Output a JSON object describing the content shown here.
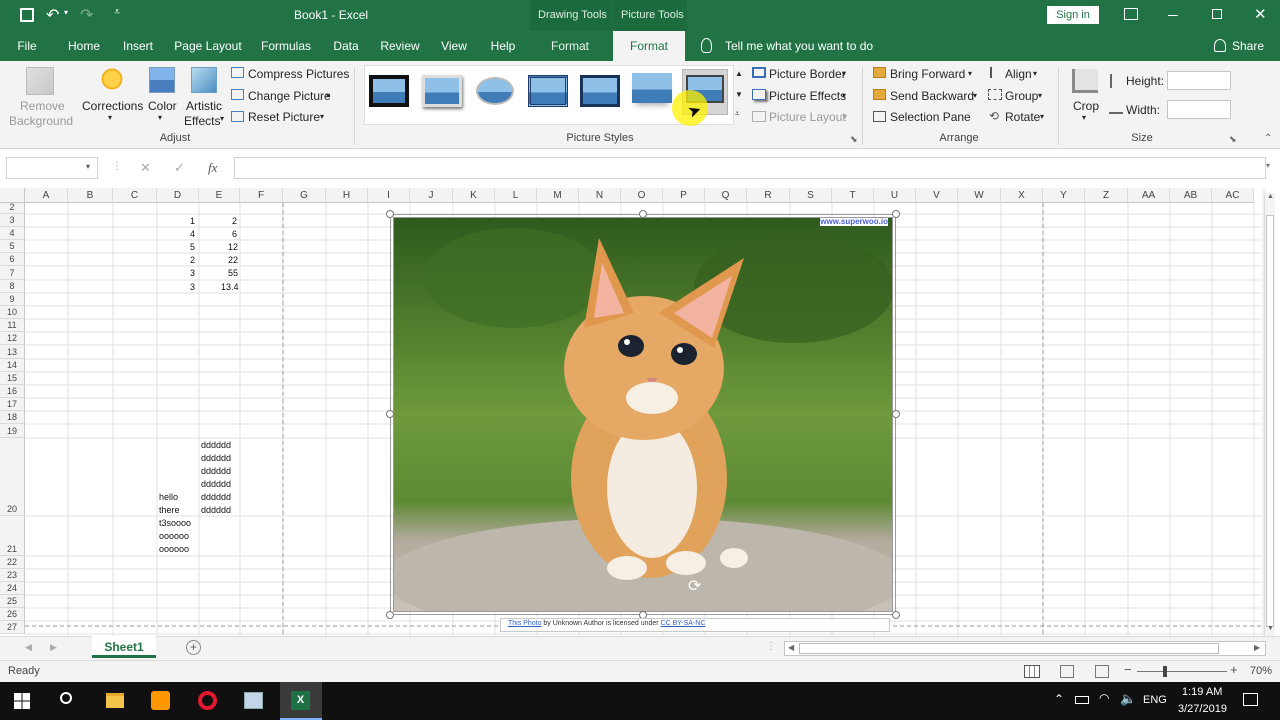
{
  "title_bar": {
    "doc_title": "Book1  -  Excel",
    "ctx1": "Drawing Tools",
    "ctx2": "Picture Tools",
    "sign_in": "Sign in"
  },
  "tabs": [
    {
      "label": "File"
    },
    {
      "label": "Home"
    },
    {
      "label": "Insert"
    },
    {
      "label": "Page Layout"
    },
    {
      "label": "Formulas"
    },
    {
      "label": "Data"
    },
    {
      "label": "Review"
    },
    {
      "label": "View"
    },
    {
      "label": "Help"
    },
    {
      "label": "Format"
    },
    {
      "label": "Format"
    }
  ],
  "tell_me": "Tell me what you want to do",
  "share": "Share",
  "ribbon": {
    "remove_bg_1": "Remove",
    "remove_bg_2": "Background",
    "corrections": "Corrections",
    "color": "Color",
    "artistic_1": "Artistic",
    "artistic_2": "Effects",
    "compress": "Compress Pictures",
    "change": "Change Picture",
    "reset": "Reset Picture",
    "adjust": "Adjust",
    "picture_styles": "Picture Styles",
    "border": "Picture Border",
    "effects": "Picture Effects",
    "layout": "Picture Layout",
    "bring_forward": "Bring Forward",
    "send_backward": "Send Backward",
    "selection_pane": "Selection Pane",
    "align": "Align",
    "group": "Group",
    "rotate": "Rotate",
    "arrange": "Arrange",
    "crop": "Crop",
    "height": "Height:",
    "width": "Width:",
    "size": "Size"
  },
  "formula": {
    "fx": "fx",
    "cancel": "✕",
    "enter": "✓"
  },
  "columns": [
    "A",
    "B",
    "C",
    "D",
    "E",
    "F",
    "G",
    "H",
    "I",
    "J",
    "K",
    "L",
    "M",
    "N",
    "O",
    "P",
    "Q",
    "R",
    "S",
    "T",
    "U",
    "V",
    "W",
    "X",
    "Y",
    "Z",
    "AA",
    "AB",
    "AC"
  ],
  "rows": [
    "2",
    "3",
    "4",
    "5",
    "6",
    "7",
    "8",
    "9",
    "10",
    "11",
    "12",
    "13",
    "14",
    "15",
    "16",
    "17",
    "18",
    "19",
    "20",
    "21",
    "22",
    "23",
    "24",
    "25",
    "26",
    "27"
  ],
  "cells": {
    "d3": "1",
    "e3": "2",
    "d4": "4",
    "e4": "6",
    "d5": "5",
    "e5": "12",
    "d6": "2",
    "e6": "22",
    "d7": "3",
    "e7": "55",
    "d8": "3",
    "e8": "13.4",
    "e20": [
      "dddddd",
      "dddddd",
      "dddddd",
      "dddddd",
      "dddddd",
      "dddddd"
    ],
    "d20": [
      "hello",
      "there"
    ],
    "d21": [
      "t3soooo",
      "oooooo",
      "oooooo"
    ]
  },
  "picture": {
    "watermark": "www.superwoo.io",
    "caption_link": "This Photo",
    "caption_mid": " by Unknown Author is licensed under ",
    "caption_license": "CC BY-SA-NC"
  },
  "sheet_tab": "Sheet1",
  "status": {
    "ready": "Ready",
    "zoom": "70%"
  },
  "taskbar": {
    "lang": "ENG",
    "time": "1:19 AM",
    "date": "3/27/2019"
  },
  "colors": {
    "excel_green": "#217346",
    "taskbar": "#101010"
  }
}
